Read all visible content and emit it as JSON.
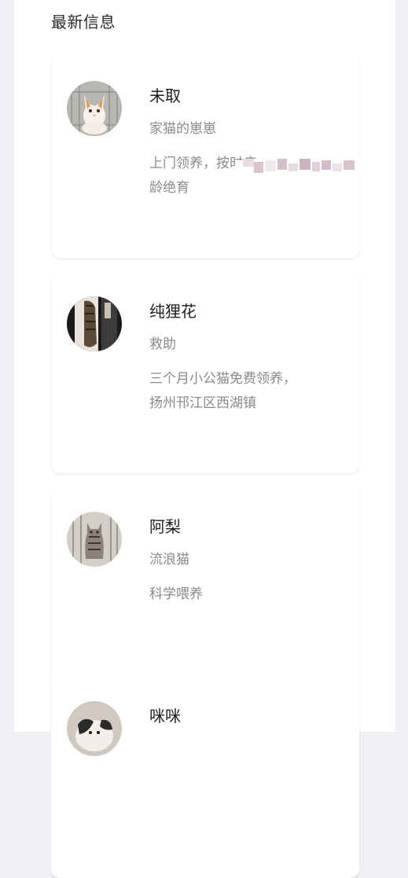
{
  "header": {
    "title": "最新信息"
  },
  "posts": [
    {
      "name": "未取",
      "category": "家猫的崽崽",
      "desc_lines": [
        "上门领养，按时疫",
        "龄绝育"
      ],
      "avatar_icon": "cat-photo-orange-white"
    },
    {
      "name": "纯狸花",
      "category": "救助",
      "desc_lines": [
        "三个月小公猫免费领养，",
        "扬州邗江区西湖镇"
      ],
      "avatar_icon": "cat-photo-tabby-dark"
    },
    {
      "name": "阿梨",
      "category": "流浪猫",
      "desc_lines": [
        "科学喂养"
      ],
      "avatar_icon": "cat-photo-tabby-grey"
    },
    {
      "name": "咪咪",
      "category": "",
      "desc_lines": [],
      "avatar_icon": "cat-photo-black-white"
    }
  ],
  "colors": {
    "page_bg": "#eef0f4",
    "panel_bg": "#ffffff",
    "title": "#2b2b2b",
    "meta": "#8a8a8a"
  }
}
